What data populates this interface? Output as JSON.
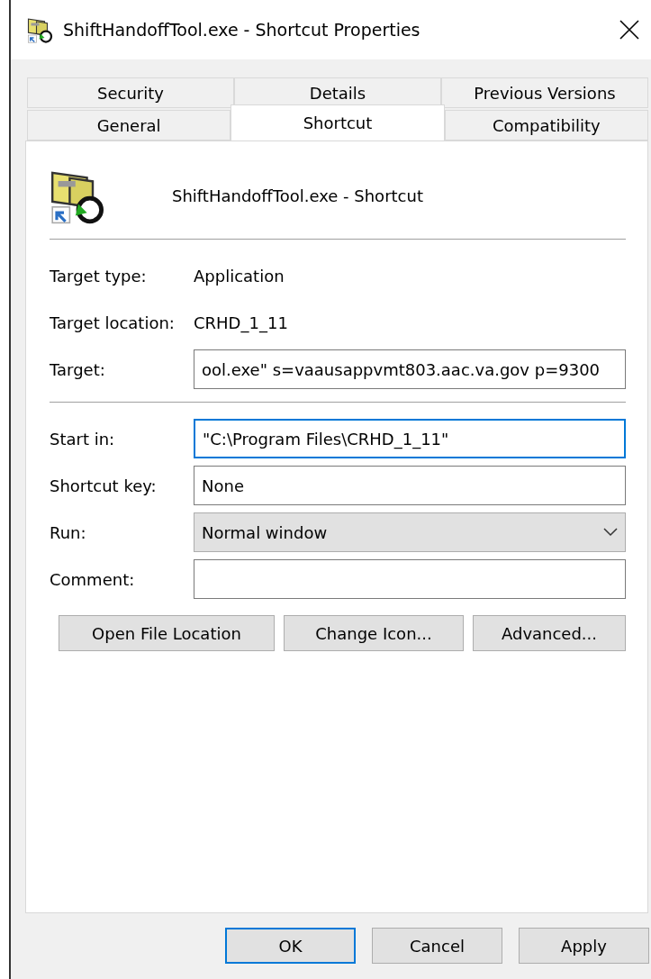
{
  "window": {
    "title": "ShiftHandoffTool.exe - Shortcut Properties"
  },
  "tab_rows": [
    [
      {
        "label": "Security",
        "selected": false
      },
      {
        "label": "Details",
        "selected": false
      },
      {
        "label": "Previous Versions",
        "selected": false
      }
    ],
    [
      {
        "label": "General",
        "selected": false
      },
      {
        "label": "Shortcut",
        "selected": true
      },
      {
        "label": "Compatibility",
        "selected": false
      }
    ]
  ],
  "shortcut_name": "ShiftHandoffTool.exe - Shortcut",
  "info": [
    {
      "label": "Target type:",
      "value": "Application"
    },
    {
      "label": "Target location:",
      "value": "CRHD_1_11"
    }
  ],
  "target": {
    "label": "Target:",
    "value": "ool.exe\" s=vaausappvmt803.aac.va.gov p=9300",
    "focused": false
  },
  "fields": [
    {
      "kind": "text",
      "label": "Start in:",
      "value": "\"C:\\Program Files\\CRHD_1_11\"",
      "focused": true
    },
    {
      "kind": "text",
      "label": "Shortcut key:",
      "value": "None",
      "focused": false
    },
    {
      "kind": "dropdown",
      "label": "Run:",
      "value": "Normal window",
      "focused": false
    },
    {
      "kind": "text",
      "label": "Comment:",
      "focused": false
    }
  ],
  "actions": [
    "Open File Location",
    "Change Icon...",
    "Advanced..."
  ],
  "buttons": [
    {
      "label": "OK",
      "default": true
    },
    {
      "label": "Cancel",
      "default": false
    },
    {
      "label": "Apply",
      "default": false
    }
  ]
}
